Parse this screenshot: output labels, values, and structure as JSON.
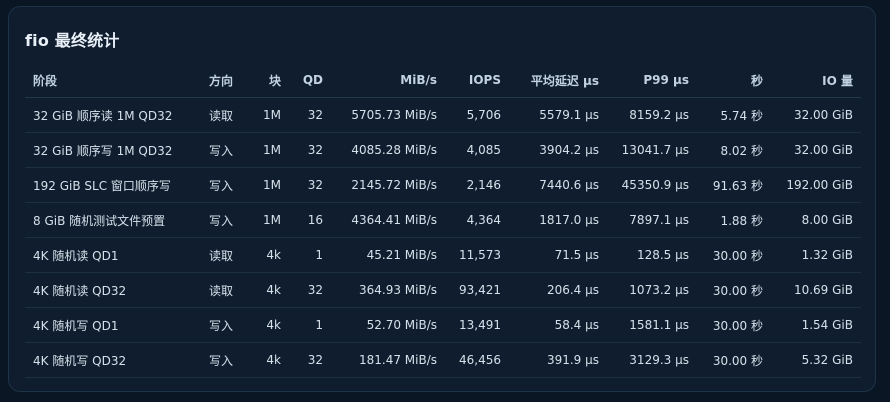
{
  "title": "fio 最终统计",
  "headers": {
    "stage": "阶段",
    "direction": "方向",
    "block": "块",
    "qd": "QD",
    "mibs": "MiB/s",
    "iops": "IOPS",
    "avg_latency": "平均延迟 µs",
    "p99": "P99 µs",
    "seconds": "秒",
    "io": "IO 量"
  },
  "rows": [
    {
      "stage": "32 GiB 顺序读 1M QD32",
      "direction": "读取",
      "block": "1M",
      "qd": "32",
      "mibs": "5705.73 MiB/s",
      "iops": "5,706",
      "avg_latency": "5579.1 µs",
      "p99": "8159.2 µs",
      "seconds": "5.74 秒",
      "io": "32.00 GiB"
    },
    {
      "stage": "32 GiB 顺序写 1M QD32",
      "direction": "写入",
      "block": "1M",
      "qd": "32",
      "mibs": "4085.28 MiB/s",
      "iops": "4,085",
      "avg_latency": "3904.2 µs",
      "p99": "13041.7 µs",
      "seconds": "8.02 秒",
      "io": "32.00 GiB"
    },
    {
      "stage": "192 GiB SLC 窗口顺序写",
      "direction": "写入",
      "block": "1M",
      "qd": "32",
      "mibs": "2145.72 MiB/s",
      "iops": "2,146",
      "avg_latency": "7440.6 µs",
      "p99": "45350.9 µs",
      "seconds": "91.63 秒",
      "io": "192.00 GiB"
    },
    {
      "stage": "8 GiB 随机测试文件预置",
      "direction": "写入",
      "block": "1M",
      "qd": "16",
      "mibs": "4364.41 MiB/s",
      "iops": "4,364",
      "avg_latency": "1817.0 µs",
      "p99": "7897.1 µs",
      "seconds": "1.88 秒",
      "io": "8.00 GiB"
    },
    {
      "stage": "4K 随机读 QD1",
      "direction": "读取",
      "block": "4k",
      "qd": "1",
      "mibs": "45.21 MiB/s",
      "iops": "11,573",
      "avg_latency": "71.5 µs",
      "p99": "128.5 µs",
      "seconds": "30.00 秒",
      "io": "1.32 GiB"
    },
    {
      "stage": "4K 随机读 QD32",
      "direction": "读取",
      "block": "4k",
      "qd": "32",
      "mibs": "364.93 MiB/s",
      "iops": "93,421",
      "avg_latency": "206.4 µs",
      "p99": "1073.2 µs",
      "seconds": "30.00 秒",
      "io": "10.69 GiB"
    },
    {
      "stage": "4K 随机写 QD1",
      "direction": "写入",
      "block": "4k",
      "qd": "1",
      "mibs": "52.70 MiB/s",
      "iops": "13,491",
      "avg_latency": "58.4 µs",
      "p99": "1581.1 µs",
      "seconds": "30.00 秒",
      "io": "1.54 GiB"
    },
    {
      "stage": "4K 随机写 QD32",
      "direction": "写入",
      "block": "4k",
      "qd": "32",
      "mibs": "181.47 MiB/s",
      "iops": "46,456",
      "avg_latency": "391.9 µs",
      "p99": "3129.3 µs",
      "seconds": "30.00 秒",
      "io": "5.32 GiB"
    }
  ]
}
